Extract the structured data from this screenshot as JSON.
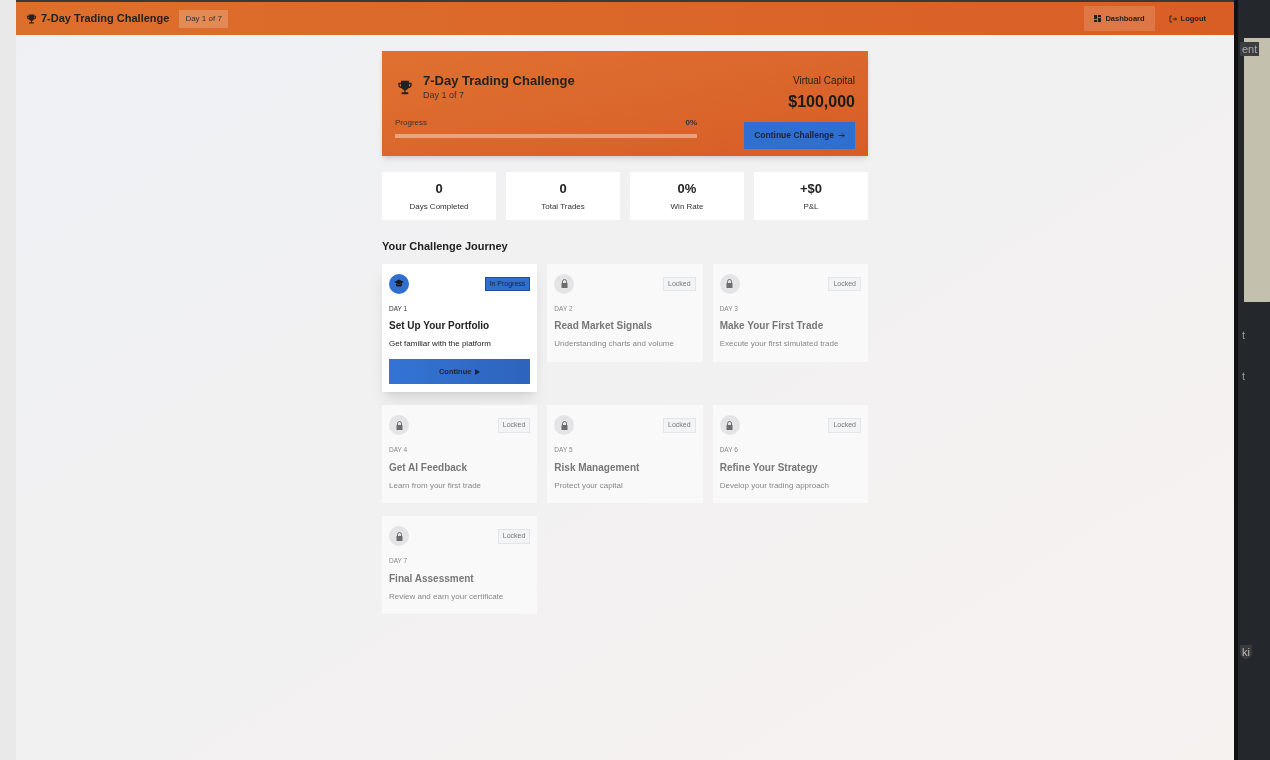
{
  "header": {
    "title": "7-Day Trading Challenge",
    "day_badge": "Day 1 of 7",
    "nav": [
      {
        "label": "Dashboard",
        "kind": "dashboard",
        "selected": true
      },
      {
        "label": "Logout",
        "kind": "logout",
        "selected": false
      }
    ]
  },
  "hero": {
    "title": "7-Day Trading Challenge",
    "subtitle": "Day 1 of 7",
    "progress_label": "Progress",
    "progress_reading": "0%",
    "level": 0,
    "capital_label": "Virtual Capital",
    "capital": "$100,000",
    "button": "Continue Challenge"
  },
  "stats": [
    {
      "value": "0",
      "label": "Days Completed"
    },
    {
      "value": "0",
      "label": "Total Trades"
    },
    {
      "value": "0%",
      "label": "Win Rate"
    },
    {
      "value": "+$0",
      "label": "P&L"
    }
  ],
  "journey": {
    "heading": "Your Challenge Journey",
    "days": [
      {
        "kind": "in_progress",
        "day": "DAY 1",
        "title": "Set Up Your Portfolio",
        "description": "Get familiar with the platform",
        "status": "In Progress",
        "button": "Continue"
      },
      {
        "kind": "locked",
        "day": "DAY 2",
        "title": "Read Market Signals",
        "description": "Understanding charts and volume",
        "status": "Locked"
      },
      {
        "kind": "locked",
        "day": "DAY 3",
        "title": "Make Your First Trade",
        "description": "Execute your first simulated trade",
        "status": "Locked"
      },
      {
        "kind": "locked",
        "day": "DAY 4",
        "title": "Get AI Feedback",
        "description": "Learn from your first trade",
        "status": "Locked"
      },
      {
        "kind": "locked",
        "day": "DAY 5",
        "title": "Risk Management",
        "description": "Protect your capital",
        "status": "Locked"
      },
      {
        "kind": "locked",
        "day": "DAY 6",
        "title": "Refine Your Strategy",
        "description": "Develop your trading approach",
        "status": "Locked"
      },
      {
        "kind": "locked",
        "day": "DAY 7",
        "title": "Final Assessment",
        "description": "Review and earn your certificate",
        "status": "Locked"
      }
    ]
  },
  "background_window": {
    "texts": [
      "ent",
      "t",
      "t",
      "ki"
    ]
  }
}
